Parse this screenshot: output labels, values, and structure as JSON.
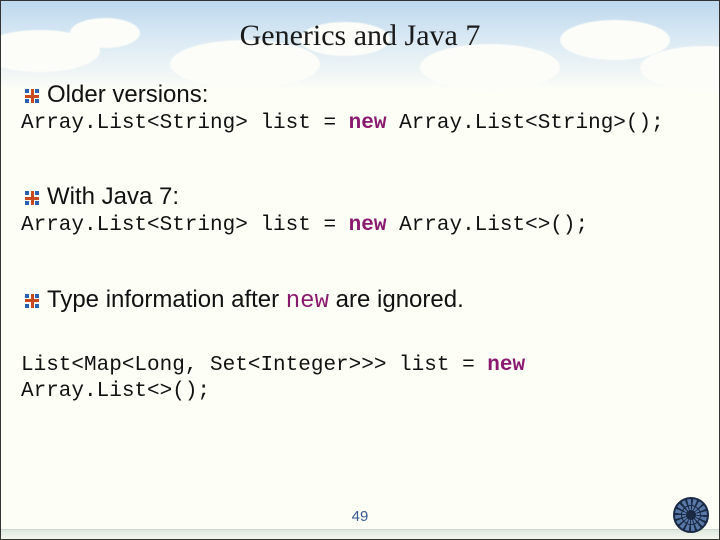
{
  "title": "Generics and Java 7",
  "bullets": {
    "b1": "Older versions:",
    "b2": "With Java 7:",
    "b3_pre": "Type information after ",
    "b3_kw": "new",
    "b3_post": " are ignored."
  },
  "code": {
    "c1a": "Array.List<String> list = ",
    "c1kw": "new",
    "c1b": " Array.List<String>();",
    "c2a": "Array.List<String> list = ",
    "c2kw": "new",
    "c2b": " Array.List<>();",
    "c3a": "List<Map<Long, Set<Integer>>> list = ",
    "c3kw": "new",
    "c3b": "\nArray.List<>();"
  },
  "page_number": "49"
}
